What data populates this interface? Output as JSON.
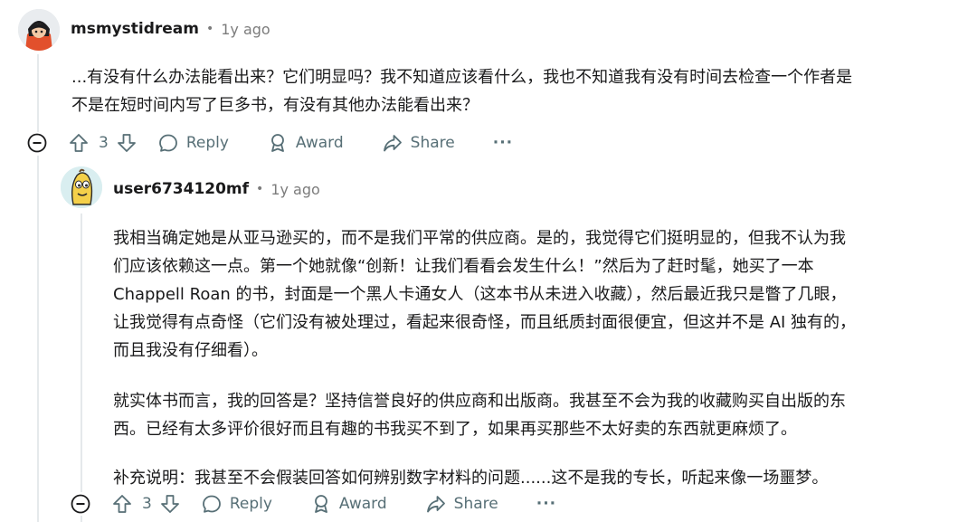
{
  "comment1": {
    "username": "msmystidream",
    "separator": "•",
    "timestamp": "1y ago",
    "lines": [
      "...有没有什么办法能看出来？它们明显吗？我不知道应该看什么，我也不知道我有没有时间去检查一个作者是",
      "不是在短时间内写了巨多书，有没有其他办法能看出来？"
    ],
    "votes": "3",
    "reply_label": "Reply",
    "award_label": "Award",
    "share_label": "Share",
    "more_label": "···"
  },
  "comment2": {
    "username": "user6734120mf",
    "separator": "•",
    "timestamp": "1y ago",
    "paragraphs": [
      [
        "我相当确定她是从亚马逊买的，而不是我们平常的供应商。是的，我觉得它们挺明显的，但我不认为我",
        "们应该依赖这一点。第一个她就像“创新！让我们看看会发生什么！”然后为了赶时髦，她买了一本",
        "Chappell Roan 的书，封面是一个黑人卡通女人（这本书从未进入收藏），然后最近我只是瞥了几眼，",
        "让我觉得有点奇怪（它们没有被处理过，看起来很奇怪，而且纸质封面很便宜，但这并不是 AI 独有的，",
        "而且我没有仔细看）。"
      ],
      [
        "就实体书而言，我的回答是？坚持信誉良好的供应商和出版商。我甚至不会为我的收藏购买自出版的东",
        "西。已经有太多评价很好而且有趣的书我买不到了，如果再买那些不太好卖的东西就更麻烦了。"
      ],
      [
        "补充说明：我甚至不会假装回答如何辨别数字材料的问题......这不是我的专长，听起来像一场噩梦。"
      ]
    ],
    "votes": "3",
    "reply_label": "Reply",
    "award_label": "Award",
    "share_label": "Share",
    "more_label": "···"
  },
  "colors": {
    "text": "#1a1a1b",
    "meta": "#7c7c7c",
    "action": "#576f76",
    "thread": "#e5e9eb"
  },
  "icons": [
    "avatar-red-hair",
    "avatar-banana",
    "collapse-icon",
    "upvote-icon",
    "downvote-icon",
    "reply-icon",
    "award-icon",
    "share-icon",
    "more-icon"
  ]
}
